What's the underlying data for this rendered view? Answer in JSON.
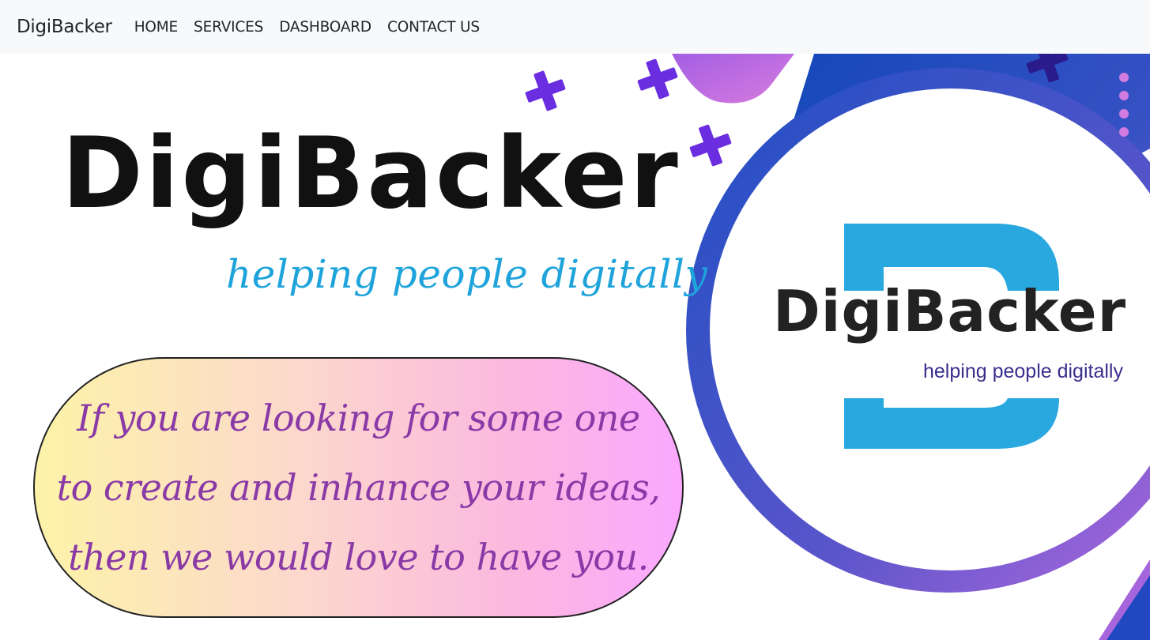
{
  "navbar": {
    "brand": "DigiBacker",
    "links": [
      {
        "label": "HOME"
      },
      {
        "label": "SERVICES"
      },
      {
        "label": "DASHBOARD"
      },
      {
        "label": "CONTACT US"
      }
    ]
  },
  "hero": {
    "logo_text": "DigiBacker",
    "tagline": "helping people digitally",
    "message_lines": [
      "If you are looking for some one",
      "to create and inhance your ideas,",
      "then we would love to have you."
    ]
  },
  "badge": {
    "title": "DigiBacker",
    "subtitle": "helping people digitally"
  },
  "colors": {
    "navbar_bg": "#f8f9fa",
    "tagline": "#1fa3db",
    "message_text": "#8a3aa6",
    "plus_purple": "#6a2ee0",
    "blue_band": "#1f4fc2",
    "pink_accent": "#c56cdc",
    "badge_d_blue": "#29a8e0"
  },
  "icons": [
    "plus-icon",
    "dots-icon"
  ]
}
